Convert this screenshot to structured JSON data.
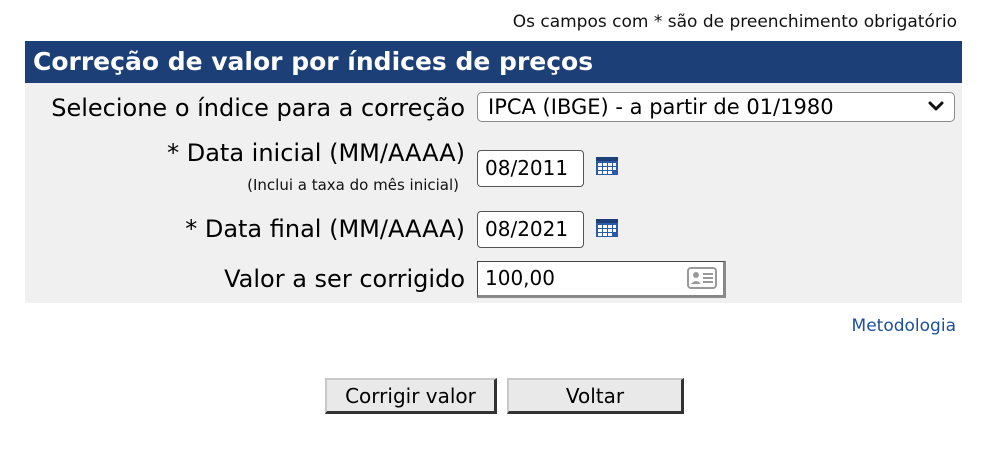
{
  "required_note": "Os campos com * são de preenchimento obrigatório",
  "panel": {
    "title": "Correção de valor por índices de preços",
    "header_color": "#1c3f77",
    "index_label": "Selecione o índice para a correção",
    "index_selected": "IPCA (IBGE) - a partir de 01/1980",
    "start_label": "* Data inicial (MM/AAAA)",
    "start_hint": "(Inclui a taxa do mês inicial)",
    "start_value": "08/2011",
    "end_label": "* Data final (MM/AAAA)",
    "end_value": "08/2021",
    "amount_label": "Valor a ser corrigido",
    "amount_value": "100,00",
    "icons": [
      "chevron-down-icon",
      "calendar-icon",
      "calendar-icon",
      "contact-card-icon"
    ]
  },
  "methodology_link": "Metodologia",
  "link_color": "#1d4f9c",
  "buttons": {
    "correct": "Corrigir valor",
    "back": "Voltar"
  }
}
